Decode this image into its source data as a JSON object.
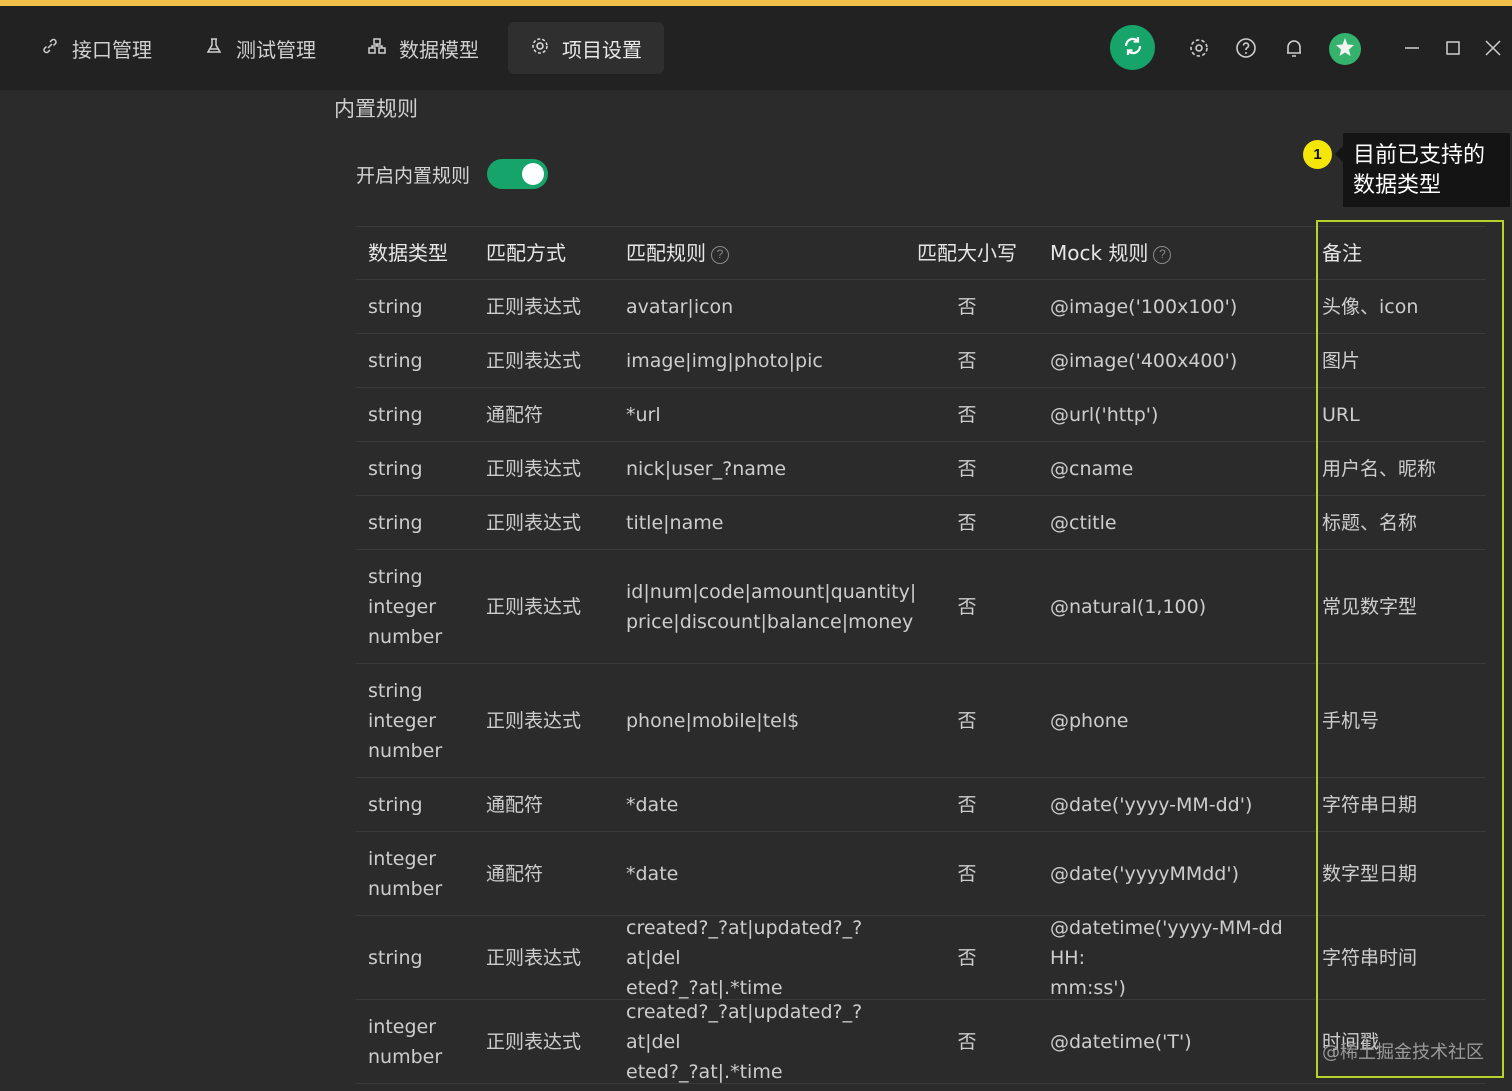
{
  "titlebar": {
    "tabs": [
      {
        "label": "接口管理",
        "icon": "link-icon"
      },
      {
        "label": "测试管理",
        "icon": "flask-icon"
      },
      {
        "label": "数据模型",
        "icon": "model-icon"
      },
      {
        "label": "项目设置",
        "icon": "gear-icon",
        "active": true
      }
    ],
    "accent_color": "#17a46a"
  },
  "section": {
    "title": "内置规则",
    "toggle_label": "开启内置规则",
    "toggle_on": true
  },
  "callout": {
    "badge": "1",
    "text": "目前已支持的数据类型"
  },
  "table": {
    "columns": [
      "数据类型",
      "匹配方式",
      "匹配规则",
      "匹配大小写",
      "Mock 规则",
      "备注"
    ],
    "help_mark": "?",
    "rows": [
      {
        "type": "string",
        "method": "正则表达式",
        "rule": "avatar|icon",
        "case": "否",
        "mock": "@image('100x100')",
        "note": "头像、icon"
      },
      {
        "type": "string",
        "method": "正则表达式",
        "rule": "image|img|photo|pic",
        "case": "否",
        "mock": "@image('400x400')",
        "note": "图片"
      },
      {
        "type": "string",
        "method": "通配符",
        "rule": "*url",
        "case": "否",
        "mock": "@url('http')",
        "note": "URL"
      },
      {
        "type": "string",
        "method": "正则表达式",
        "rule": "nick|user_?name",
        "case": "否",
        "mock": "@cname",
        "note": "用户名、昵称"
      },
      {
        "type": "string",
        "method": "正则表达式",
        "rule": "title|name",
        "case": "否",
        "mock": "@ctitle",
        "note": "标题、名称"
      },
      {
        "type": "string\ninteger\nnumber",
        "method": "正则表达式",
        "rule": "id|num|code|amount|quantity|\nprice|discount|balance|money",
        "case": "否",
        "mock": "@natural(1,100)",
        "note": "常见数字型"
      },
      {
        "type": "string\ninteger\nnumber",
        "method": "正则表达式",
        "rule": "phone|mobile|tel$",
        "case": "否",
        "mock": "@phone",
        "note": "手机号"
      },
      {
        "type": "string",
        "method": "通配符",
        "rule": "*date",
        "case": "否",
        "mock": "@date('yyyy-MM-dd')",
        "note": "字符串日期"
      },
      {
        "type": "integer\nnumber",
        "method": "通配符",
        "rule": "*date",
        "case": "否",
        "mock": "@date('yyyyMMdd')",
        "note": "数字型日期"
      },
      {
        "type": "string",
        "method": "正则表达式",
        "rule": "created?_?at|updated?_?at|del\neted?_?at|.*time",
        "case": "否",
        "mock": "@datetime('yyyy-MM-dd HH:\nmm:ss')",
        "note": "字符串时间"
      },
      {
        "type": "integer\nnumber",
        "method": "正则表达式",
        "rule": "created?_?at|updated?_?at|del\neted?_?at|.*time",
        "case": "否",
        "mock": "@datetime('T')",
        "note": "时间戳"
      }
    ]
  },
  "watermark": "@稀土掘金技术社区"
}
